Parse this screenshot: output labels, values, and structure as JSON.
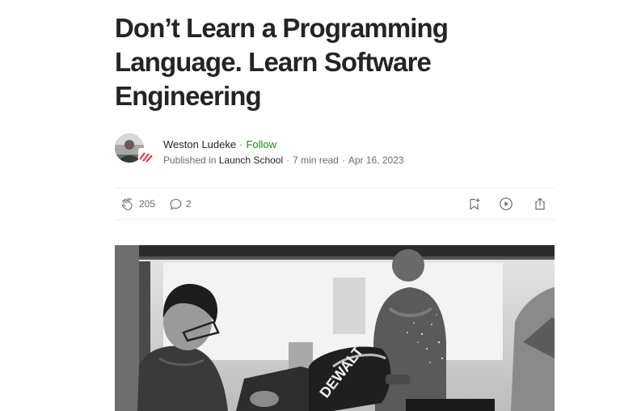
{
  "article": {
    "title": "Don’t Learn a Programming Language. Learn Software Engineering"
  },
  "author": {
    "name": "Weston Ludeke",
    "follow_label": "Follow",
    "separator": "·",
    "published_in_label": "Published in",
    "publication": "Launch School",
    "read_time": "7 min read",
    "date": "Apr 16, 2023"
  },
  "actions": {
    "claps": "205",
    "responses": "2",
    "icons": [
      "clap-icon",
      "response-icon",
      "bookmark-add-icon",
      "play-icon",
      "share-icon"
    ]
  },
  "hero_image": {
    "brand_text": "DEWALT",
    "style": "black-and-white photo"
  },
  "colors": {
    "text": "#242424",
    "muted": "#6b6b6b",
    "follow": "#1a8917",
    "divider": "#f0f0f0"
  }
}
